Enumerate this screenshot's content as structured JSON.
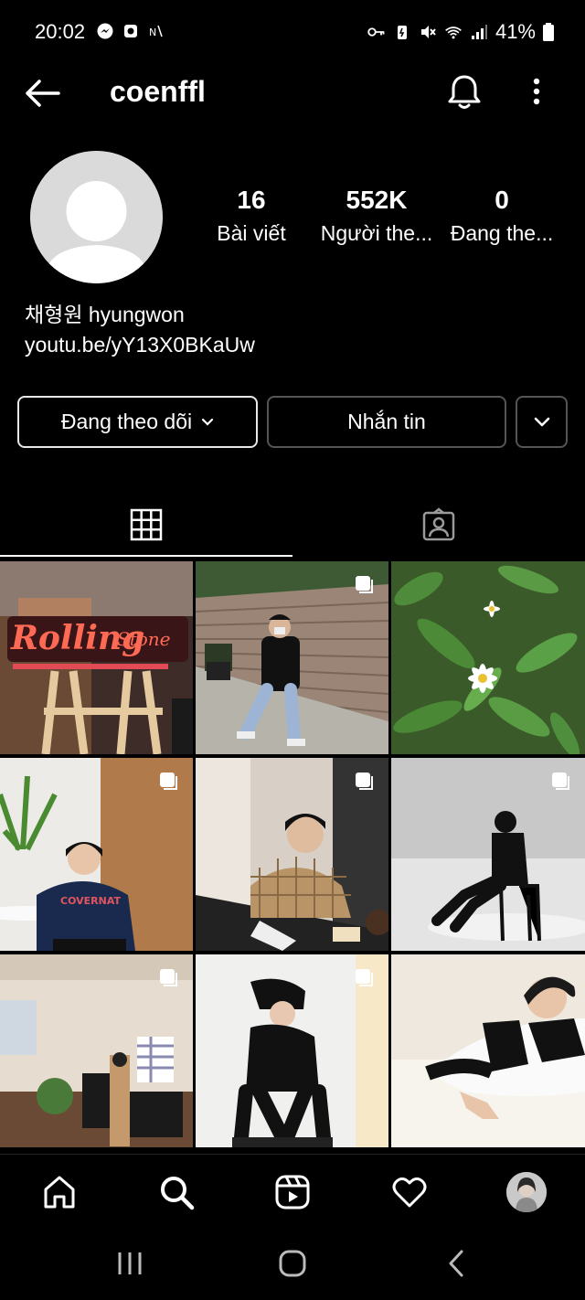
{
  "status_bar": {
    "time": "20:02",
    "battery": "41%"
  },
  "header": {
    "username": "coenffl"
  },
  "profile": {
    "stats": [
      {
        "value": "16",
        "label": "Bài viết"
      },
      {
        "value": "552K",
        "label": "Người the..."
      },
      {
        "value": "0",
        "label": "Đang the..."
      }
    ],
    "bio_name": "채형원 hyungwon",
    "bio_link": "youtu.be/yY13X0BKaUw"
  },
  "actions": {
    "following_label": "Đang theo dõi",
    "message_label": "Nhắn tin"
  },
  "posts": [
    {
      "subject": "rolling-stone-neon-sign",
      "multi": false
    },
    {
      "subject": "man-sitting-by-brick-wall",
      "multi": true
    },
    {
      "subject": "daisy-flowers-in-grass",
      "multi": false
    },
    {
      "subject": "man-in-navy-tshirt-with-plants",
      "multi": true
    },
    {
      "subject": "man-in-plaid-shirt-at-table",
      "multi": true
    },
    {
      "subject": "silhouette-man-on-chair",
      "multi": true
    },
    {
      "subject": "room-with-amplifier",
      "multi": true
    },
    {
      "subject": "man-crouching-in-black",
      "multi": true
    },
    {
      "subject": "man-leaning-on-white-table",
      "multi": false
    }
  ],
  "bottom_nav": [
    "home-icon",
    "search-icon",
    "reels-icon",
    "heart-icon",
    "profile-avatar"
  ],
  "colors": {
    "background": "#000000",
    "text": "#ffffff",
    "border_muted": "#555555"
  }
}
